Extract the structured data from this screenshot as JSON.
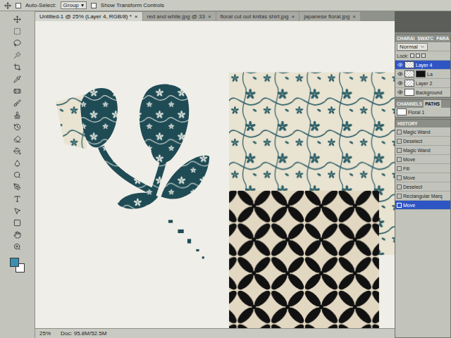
{
  "options_bar": {
    "auto_select_label": "Auto-Select:",
    "auto_select_checked": false,
    "auto_select_value": "Group",
    "dropdown_arrow": "▾",
    "transform_label": "Show Transform Controls",
    "transform_checked": false
  },
  "document_tabs": [
    {
      "label": "Untitled-1 @ 25% (Layer 4, RGB/8) *",
      "selected": true,
      "close": "×"
    },
    {
      "label": "red and white.jpg @ 33",
      "selected": false,
      "close": "×"
    },
    {
      "label": "floral cut out knitas shirt.jpg",
      "selected": false,
      "close": "×"
    },
    {
      "label": "japanese floral.jpg",
      "selected": false,
      "close": "×"
    }
  ],
  "layers_panel": {
    "tabs": [
      {
        "label": "CHARAI",
        "selected": false
      },
      {
        "label": "SWATC",
        "selected": false
      },
      {
        "label": "PARA",
        "selected": false
      }
    ],
    "blend_mode": "Normal",
    "lock_label": "Lock:",
    "layers": [
      {
        "name": "Layer 4",
        "selected": true,
        "visible": true,
        "kind": "pixel"
      },
      {
        "name": "La",
        "selected": false,
        "visible": true,
        "kind": "masked"
      },
      {
        "name": "Layer 2",
        "selected": false,
        "visible": true,
        "kind": "pixel"
      },
      {
        "name": "Background",
        "selected": false,
        "visible": true,
        "kind": "background"
      }
    ]
  },
  "paths_panel": {
    "tabs": [
      {
        "label": "CHANNELS",
        "selected": false
      },
      {
        "label": "PATHS",
        "selected": true
      }
    ],
    "paths": [
      {
        "name": "Floral 1",
        "selected": false
      }
    ]
  },
  "history_panel": {
    "title": "HISTORY",
    "items": [
      {
        "label": "Magic Wand",
        "selected": false
      },
      {
        "label": "Deselect",
        "selected": false
      },
      {
        "label": "Magic Wand",
        "selected": false
      },
      {
        "label": "Move",
        "selected": false
      },
      {
        "label": "Fill",
        "selected": false
      },
      {
        "label": "Move",
        "selected": false
      },
      {
        "label": "Deselect",
        "selected": false
      },
      {
        "label": "Rectangular Marq",
        "selected": false
      },
      {
        "label": "Move",
        "selected": true
      }
    ]
  },
  "status_bar": {
    "zoom": "25%",
    "doc": "Doc: 95.8M/52.5M"
  }
}
